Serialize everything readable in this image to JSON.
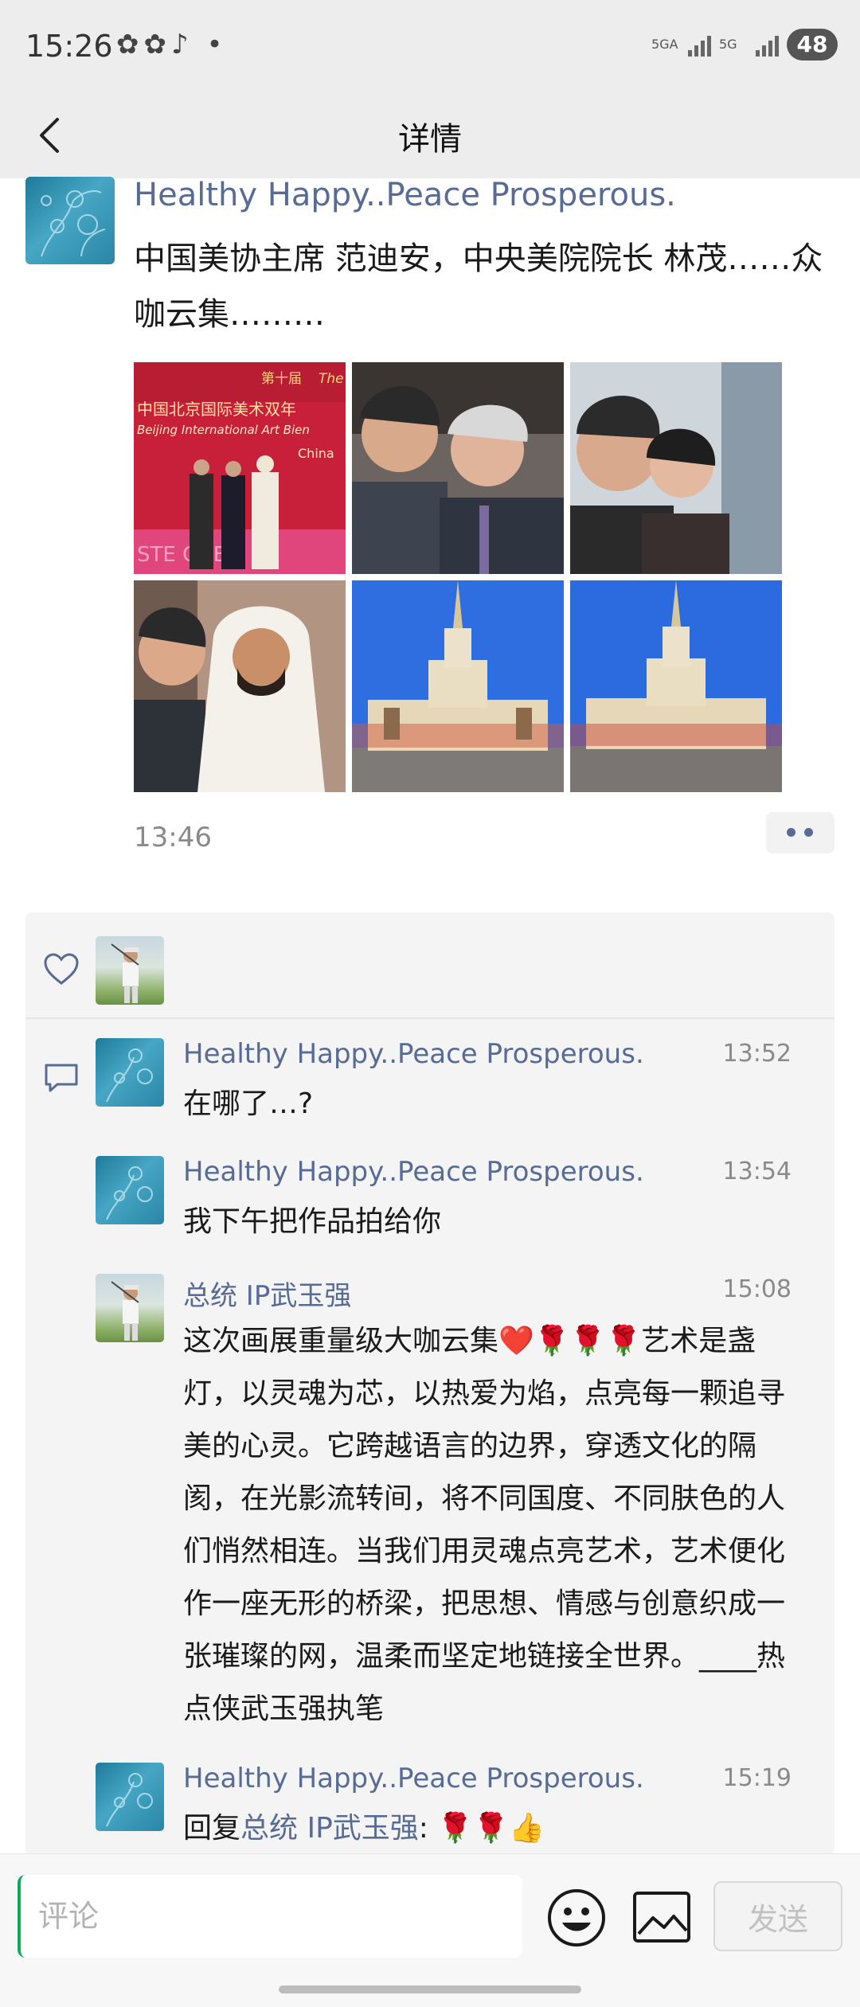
{
  "status_bar": {
    "time": "15:26",
    "notification_icons": [
      "wechat-icon",
      "wechat-icon",
      "tiktok-icon",
      "dot-icon"
    ],
    "notif_text": "✿✿♪ •",
    "signal1_label": "5GA",
    "signal2_label": "5G",
    "battery": "48"
  },
  "header": {
    "title": "详情"
  },
  "post": {
    "author": "Healthy Happy..Peace Prosperous.",
    "text": "中国美协主席 范迪安，中央美院院长 林茂……众咖云集………",
    "time": "13:46",
    "photo_overlay": {
      "banner_line1": "第十届",
      "banner_line1b": "The",
      "banner_line2": "中国北京国际美术双年",
      "banner_line3": "Beijing International Art Bien",
      "banner_line4": "China",
      "banner_line5": "STE  COEX"
    }
  },
  "comments": [
    {
      "author": "Healthy Happy..Peace Prosperous.",
      "time": "13:52",
      "text": "在哪了…?"
    },
    {
      "author": "Healthy Happy..Peace Prosperous.",
      "time": "13:54",
      "text": "我下午把作品拍给你"
    },
    {
      "author": "总统 IP武玉强",
      "time": "15:08",
      "text": "这次画展重量级大咖云集❤️🌹🌹🌹艺术是盏灯，以灵魂为芯，以热爱为焰，点亮每一颗追寻美的心灵。它跨越语言的边界，穿透文化的隔阂，在光影流转间，将不同国度、不同肤色的人们悄然相连。当我们用灵魂点亮艺术，艺术便化作一座无形的桥梁，把思想、情感与创意织成一张璀璨的网，温柔而坚定地链接全世界。____热点侠武玉强执笔"
    },
    {
      "author": "Healthy Happy..Peace Prosperous.",
      "time": "15:19",
      "reply_prefix": "回复",
      "reply_to": "总统 IP武玉强",
      "reply_sep": ": ",
      "text": "🌹🌹👍"
    }
  ],
  "input_bar": {
    "placeholder": "评论",
    "send_label": "发送"
  },
  "colors": {
    "link": "#576b95",
    "background": "#ededed",
    "accent_cursor": "#0dab5c"
  }
}
